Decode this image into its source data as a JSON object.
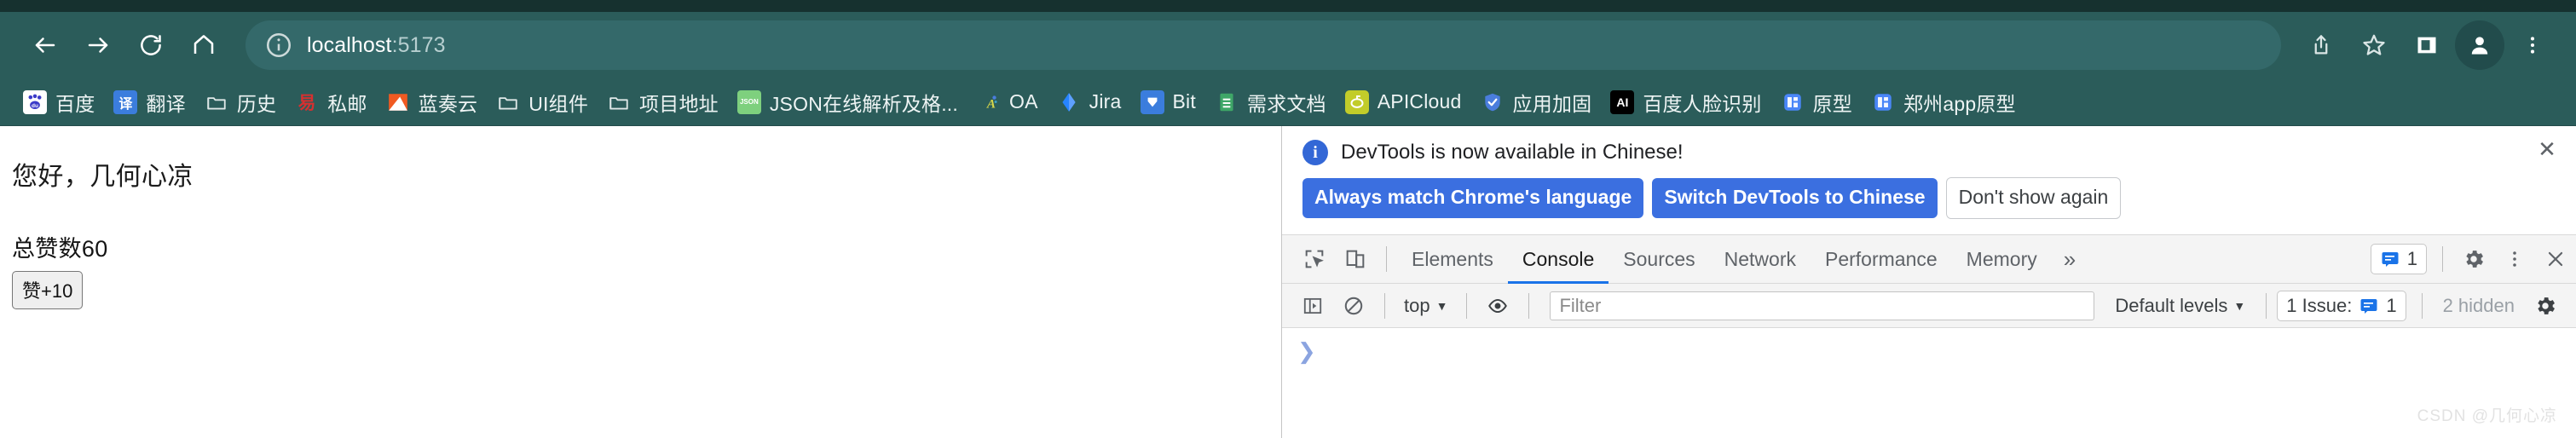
{
  "browser": {
    "nav": {
      "back_label": "Back",
      "forward_label": "Forward",
      "reload_label": "Reload",
      "home_label": "Home"
    },
    "omnibox": {
      "host": "localhost",
      "port": ":5173",
      "full_url": "localhost:5173",
      "info_icon": "info-circle-icon"
    },
    "actions": {
      "share_label": "Share",
      "bookmark_label": "Bookmark this tab",
      "sidepanel_label": "Side panel",
      "profile_label": "Profile",
      "menu_label": "Customize and control Google Chrome"
    },
    "toolbar_color": "#2b5c5a",
    "tabstrip_color": "#16312f",
    "omnibox_color": "#34696a"
  },
  "bookmarks": [
    {
      "label": "百度",
      "icon": "baidu-icon",
      "icon_type": "image",
      "bg": "#ffffff",
      "fg": "#2e2ec8",
      "glyph": "du"
    },
    {
      "label": "翻译",
      "icon": "translate-icon",
      "icon_type": "image",
      "bg": "#3b7ddd",
      "fg": "#ffffff",
      "glyph": "译"
    },
    {
      "label": "历史",
      "icon": "folder-icon",
      "icon_type": "folder",
      "bg": "none",
      "fg": "#dfe8e8",
      "glyph": ""
    },
    {
      "label": "私邮",
      "icon": "netease-mail-icon",
      "icon_type": "image",
      "bg": "none",
      "fg": "#d63030",
      "glyph": "易"
    },
    {
      "label": "蓝奏云",
      "icon": "lanzou-icon",
      "icon_type": "image",
      "bg": "#f05a22",
      "fg": "#ffffff",
      "glyph": ""
    },
    {
      "label": "UI组件",
      "icon": "folder-icon",
      "icon_type": "folder",
      "bg": "none",
      "fg": "#dfe8e8",
      "glyph": ""
    },
    {
      "label": "项目地址",
      "icon": "folder-icon",
      "icon_type": "folder",
      "bg": "none",
      "fg": "#dfe8e8",
      "glyph": ""
    },
    {
      "label": "JSON在线解析及格...",
      "icon": "json-icon",
      "icon_type": "image",
      "bg": "#7ed07e",
      "fg": "#ffffff",
      "glyph": "JSON"
    },
    {
      "label": "OA",
      "icon": "oa-icon",
      "icon_type": "image",
      "bg": "none",
      "fg": "#d6d64a",
      "glyph": "A"
    },
    {
      "label": "Jira",
      "icon": "jira-icon",
      "icon_type": "image",
      "bg": "none",
      "fg": "#2684ff",
      "glyph": ""
    },
    {
      "label": "Bit",
      "icon": "bit-icon",
      "icon_type": "image",
      "bg": "#3b7ddd",
      "fg": "#ffffff",
      "glyph": ""
    },
    {
      "label": "需求文档",
      "icon": "sheets-icon",
      "icon_type": "image",
      "bg": "#3ea667",
      "fg": "#ffffff",
      "glyph": ""
    },
    {
      "label": "APICloud",
      "icon": "apicloud-icon",
      "icon_type": "image",
      "bg": "#c2cc2a",
      "fg": "#ffffff",
      "glyph": ""
    },
    {
      "label": "应用加固",
      "icon": "shield-icon",
      "icon_type": "image",
      "bg": "none",
      "fg": "#4a7ddd",
      "glyph": ""
    },
    {
      "label": "百度人脸识别",
      "icon": "ai-icon",
      "icon_type": "image",
      "bg": "#000000",
      "fg": "#ffffff",
      "glyph": "AI"
    },
    {
      "label": "原型",
      "icon": "axure-icon",
      "icon_type": "image",
      "bg": "#4a86f7",
      "fg": "#ffffff",
      "glyph": ""
    },
    {
      "label": "郑州app原型",
      "icon": "axure-icon",
      "icon_type": "image",
      "bg": "#4a86f7",
      "fg": "#ffffff",
      "glyph": ""
    }
  ],
  "page": {
    "greeting": "您好，几何心凉",
    "likes_text": "总赞数60",
    "like_button": "赞+10"
  },
  "devtools": {
    "banner": {
      "message": "DevTools is now available in Chinese!",
      "info_icon": "info-icon",
      "primary_button": "Always match Chrome's language",
      "secondary_button": "Switch DevTools to Chinese",
      "tertiary_button": "Don't show again",
      "close_icon": "close-icon",
      "close_glyph": "✕"
    },
    "tabs": {
      "inspect_icon": "inspect-element-icon",
      "device_icon": "device-toolbar-icon",
      "items": [
        {
          "label": "Elements",
          "active": false
        },
        {
          "label": "Console",
          "active": true
        },
        {
          "label": "Sources",
          "active": false
        },
        {
          "label": "Network",
          "active": false
        },
        {
          "label": "Performance",
          "active": false
        },
        {
          "label": "Memory",
          "active": false
        }
      ],
      "overflow_glyph": "»",
      "issues_count": "1",
      "settings_icon": "gear-icon",
      "more_icon": "kebab-menu-icon",
      "close_icon": "close-icon"
    },
    "console_toolbar": {
      "sidebar_icon": "console-sidebar-icon",
      "clear_icon": "clear-console-icon",
      "context_value": "top",
      "eye_icon": "live-expression-icon",
      "filter_placeholder": "Filter",
      "levels_value": "Default levels",
      "issues_label": "1 Issue:",
      "issues_count": "1",
      "hidden_label": "2 hidden",
      "settings_icon": "gear-icon"
    },
    "console": {
      "prompt_glyph": "❯",
      "watermark": "CSDN @几何心凉"
    }
  }
}
